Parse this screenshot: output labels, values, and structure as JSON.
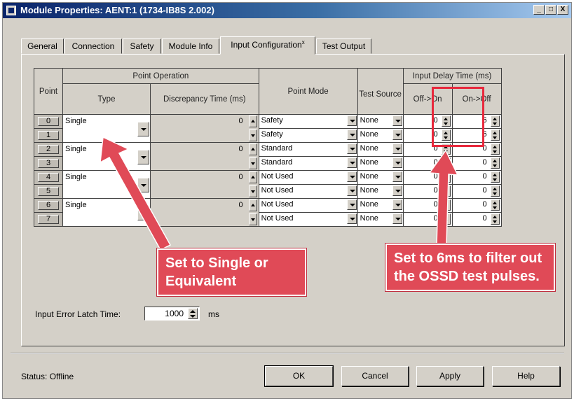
{
  "window": {
    "title": "Module Properties: AENT:1 (1734-IB8S 2.002)",
    "controls": {
      "minimize": "_",
      "maximize": "□",
      "close": "X"
    }
  },
  "tabs": [
    {
      "label": "General"
    },
    {
      "label": "Connection"
    },
    {
      "label": "Safety"
    },
    {
      "label": "Module Info"
    },
    {
      "label": "Input Configuration",
      "marker": "x",
      "active": true
    },
    {
      "label": "Test Output"
    }
  ],
  "table": {
    "headers": {
      "point": "Point",
      "point_operation": "Point Operation",
      "type": "Type",
      "discrepancy_time": "Discrepancy Time (ms)",
      "point_mode": "Point Mode",
      "test_source": "Test Source",
      "input_delay_time": "Input Delay Time (ms)",
      "off_on": "Off->On",
      "on_off": "On->Off"
    },
    "pairs": [
      {
        "type": "Single",
        "discrepancy": "0"
      },
      {
        "type": "Single",
        "discrepancy": "0"
      },
      {
        "type": "Single",
        "discrepancy": "0"
      },
      {
        "type": "Single",
        "discrepancy": "0"
      }
    ],
    "rows": [
      {
        "point": "0",
        "mode": "Safety",
        "test_source": "None",
        "off_on": "0",
        "on_off": "6"
      },
      {
        "point": "1",
        "mode": "Safety",
        "test_source": "None",
        "off_on": "0",
        "on_off": "6"
      },
      {
        "point": "2",
        "mode": "Standard",
        "test_source": "None",
        "off_on": "0",
        "on_off": "0"
      },
      {
        "point": "3",
        "mode": "Standard",
        "test_source": "None",
        "off_on": "0",
        "on_off": "0"
      },
      {
        "point": "4",
        "mode": "Not Used",
        "test_source": "None",
        "off_on": "0",
        "on_off": "0"
      },
      {
        "point": "5",
        "mode": "Not Used",
        "test_source": "None",
        "off_on": "0",
        "on_off": "0"
      },
      {
        "point": "6",
        "mode": "Not Used",
        "test_source": "None",
        "off_on": "0",
        "on_off": "0"
      },
      {
        "point": "7",
        "mode": "Not Used",
        "test_source": "None",
        "off_on": "0",
        "on_off": "0"
      }
    ]
  },
  "latch": {
    "label": "Input Error Latch Time:",
    "value": "1000",
    "unit": "ms"
  },
  "status": {
    "text": "Status:  Offline"
  },
  "buttons": {
    "ok": "OK",
    "cancel": "Cancel",
    "apply": "Apply",
    "help": "Help"
  },
  "annotations": {
    "left": "Set to Single or Equivalent",
    "right": "Set to 6ms to filter out the OSSD test pulses.",
    "color": "#e04a57"
  }
}
